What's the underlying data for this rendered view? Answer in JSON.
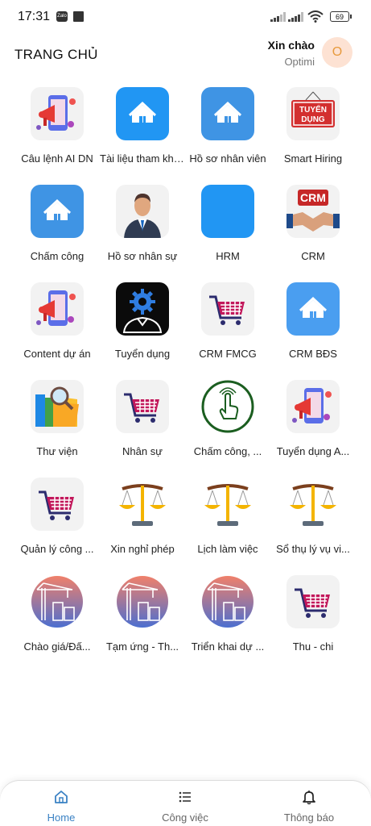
{
  "status_bar": {
    "time": "17:31",
    "zalo": "Zalo",
    "battery": "69"
  },
  "header": {
    "title": "TRANG CHỦ",
    "greeting": "Xin chào",
    "user_name": "Optimi",
    "avatar_initial": "O"
  },
  "apps": [
    {
      "label": "Câu lệnh AI DN",
      "icon": "megaphone-phone-icon"
    },
    {
      "label": "Tài liệu tham khảo",
      "icon": "home-icon"
    },
    {
      "label": "Hồ sơ nhân viên",
      "icon": "home-icon"
    },
    {
      "label": "Smart Hiring",
      "icon": "tuyen-dung-sign-icon",
      "icon_text": "TUYỂN DỤNG"
    },
    {
      "label": "Chấm công",
      "icon": "home-icon"
    },
    {
      "label": "Hồ sơ nhân sự",
      "icon": "businessman-icon"
    },
    {
      "label": "HRM",
      "icon": "blank-blue-icon"
    },
    {
      "label": "CRM",
      "icon": "crm-handshake-icon",
      "icon_text": "CRM"
    },
    {
      "label": "Content dự án",
      "icon": "megaphone-phone-icon"
    },
    {
      "label": "Tuyển dụng",
      "icon": "gear-person-icon"
    },
    {
      "label": "CRM FMCG",
      "icon": "shopping-cart-icon"
    },
    {
      "label": "CRM BĐS",
      "icon": "home-icon"
    },
    {
      "label": "Thư viện",
      "icon": "folder-magnifier-icon"
    },
    {
      "label": "Nhân sự",
      "icon": "shopping-cart-icon"
    },
    {
      "label": "Chấm công, ...",
      "icon": "fingerprint-touch-icon"
    },
    {
      "label": "Tuyển dụng A...",
      "icon": "megaphone-phone-icon"
    },
    {
      "label": "Quản lý công ...",
      "icon": "shopping-cart-icon"
    },
    {
      "label": "Xin nghỉ phép",
      "icon": "scales-icon"
    },
    {
      "label": "Lịch làm việc",
      "icon": "scales-icon"
    },
    {
      "label": "Sổ thụ lý vụ vi...",
      "icon": "scales-icon"
    },
    {
      "label": "Chào giá/Đấ...",
      "icon": "construction-crane-icon"
    },
    {
      "label": "Tạm ứng - Th...",
      "icon": "construction-crane-icon"
    },
    {
      "label": "Triển khai dự ...",
      "icon": "construction-crane-icon"
    },
    {
      "label": "Thu - chi",
      "icon": "shopping-cart-icon"
    }
  ],
  "bottom_nav": [
    {
      "label": "Home",
      "icon": "home-outline-icon",
      "active": true
    },
    {
      "label": "Công việc",
      "icon": "list-icon",
      "active": false
    },
    {
      "label": "Thông báo",
      "icon": "bell-icon",
      "active": false
    }
  ],
  "colors": {
    "accent": "#3b82c4",
    "tile_blue": "#2196f3",
    "avatar_bg": "#fde2d3"
  }
}
